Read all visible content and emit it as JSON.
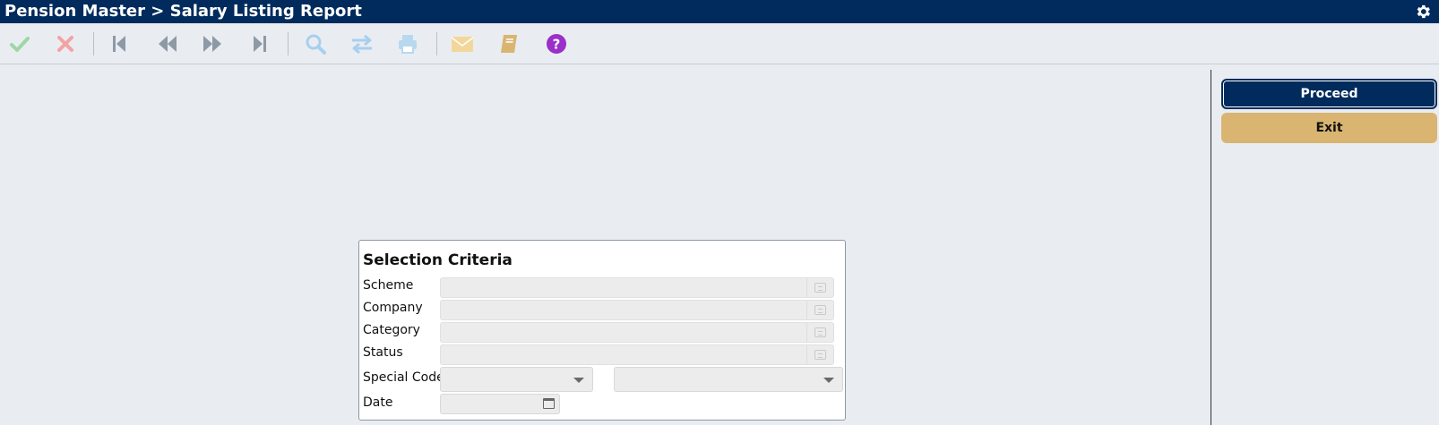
{
  "window": {
    "title": "Pension Master > Salary Listing Report"
  },
  "toolbar": {
    "icons": [
      "check-icon",
      "cancel-x-icon",
      "first-record-icon",
      "previous-record-icon",
      "next-record-icon",
      "last-record-icon",
      "search-icon",
      "swap-icon",
      "print-icon",
      "email-icon",
      "notebook-icon",
      "help-icon"
    ],
    "colors": {
      "check": "#9fd6a6",
      "cancel": "#f3a3a3",
      "nav": "#8e99a6",
      "search": "#a9cfee",
      "print": "#b8d8f0",
      "email": "#f3d79a",
      "notebook": "#d9b571",
      "help": "#9b2fc9"
    }
  },
  "actions": {
    "proceed_label": "Proceed",
    "exit_label": "Exit"
  },
  "criteria": {
    "title": "Selection Criteria",
    "scheme_label": "Scheme",
    "scheme_value": "",
    "company_label": "Company",
    "company_value": "",
    "category_label": "Category",
    "category_value": "",
    "status_label": "Status",
    "status_value": "",
    "special_code_label": "Special Code",
    "special_code_value_1": "",
    "special_code_value_2": "",
    "date_label": "Date",
    "date_value": ""
  },
  "theme": {
    "header_bg": "#002b5c",
    "exit_bg": "#d9b571",
    "page_bg": "#e9edf1"
  }
}
